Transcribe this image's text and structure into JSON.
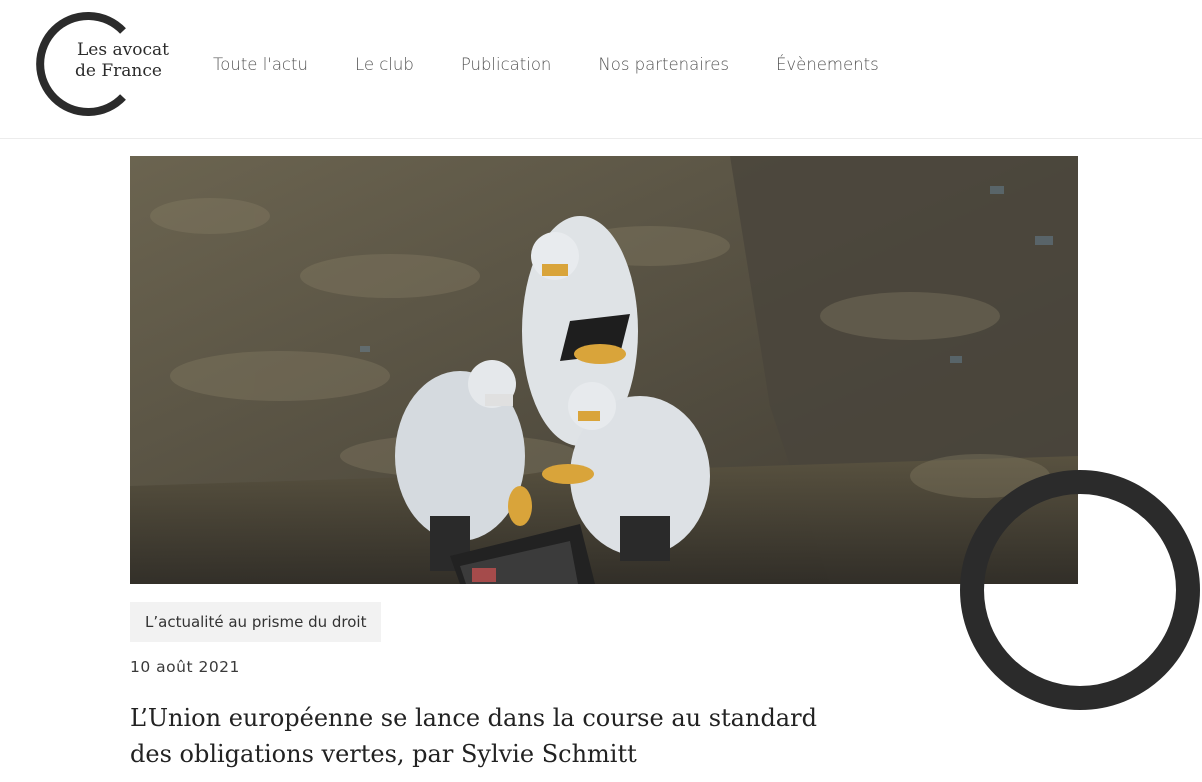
{
  "brand": {
    "logo_line1": "Les avocat",
    "logo_line2": "de France",
    "ring_color": "#2b2b2b"
  },
  "nav": {
    "items": [
      {
        "label": "Toute l'actu"
      },
      {
        "label": "Le club"
      },
      {
        "label": "Publication"
      },
      {
        "label": "Nos partenaires"
      },
      {
        "label": "Évènements"
      }
    ]
  },
  "article": {
    "image_subject": "three-scientists-in-protective-suits-at-landfill",
    "category": "L’actualité au prisme du droit",
    "date": "10 août 2021",
    "title": "L’Union européenne se lance dans la course au standard des obligations vertes, par Sylvie Schmitt"
  }
}
